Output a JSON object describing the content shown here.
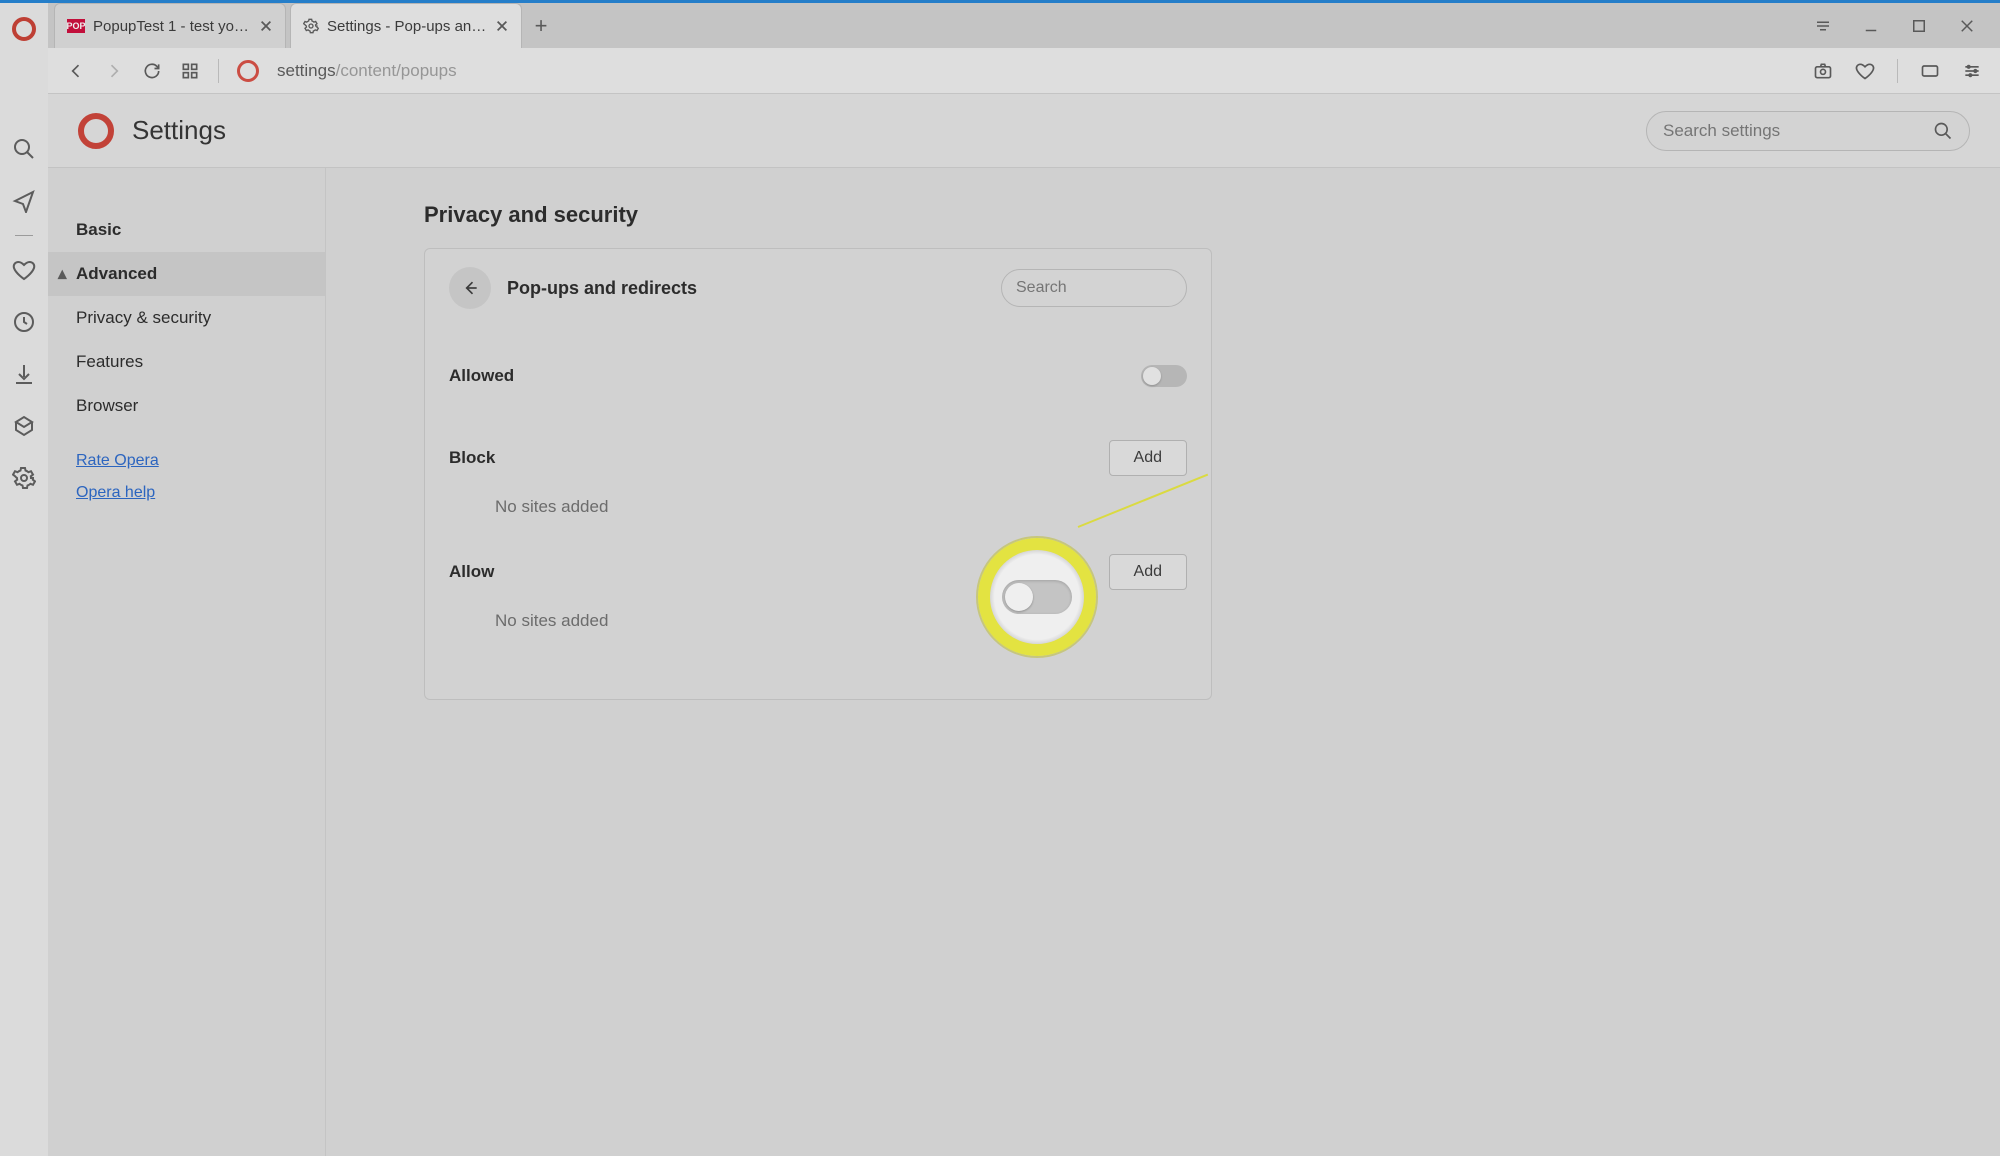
{
  "tabs": [
    {
      "title": "PopupTest 1 - test your pop",
      "active": false,
      "icon": "pop"
    },
    {
      "title": "Settings - Pop-ups and red",
      "active": true,
      "icon": "gear"
    }
  ],
  "url": {
    "scheme": "settings",
    "path": "/content/popups"
  },
  "settings_header": {
    "title": "Settings"
  },
  "search_settings": {
    "placeholder": "Search settings"
  },
  "nav": {
    "basic": "Basic",
    "advanced": "Advanced",
    "privacy": "Privacy & security",
    "features": "Features",
    "browser": "Browser",
    "rate": "Rate Opera",
    "help": "Opera help"
  },
  "section": {
    "title": "Privacy and security"
  },
  "card": {
    "title": "Pop-ups and redirects",
    "search_placeholder": "Search",
    "allowed_label": "Allowed",
    "block_label": "Block",
    "block_add": "Add",
    "block_empty": "No sites added",
    "allow_label": "Allow",
    "allow_add": "Add",
    "allow_empty": "No sites added"
  }
}
